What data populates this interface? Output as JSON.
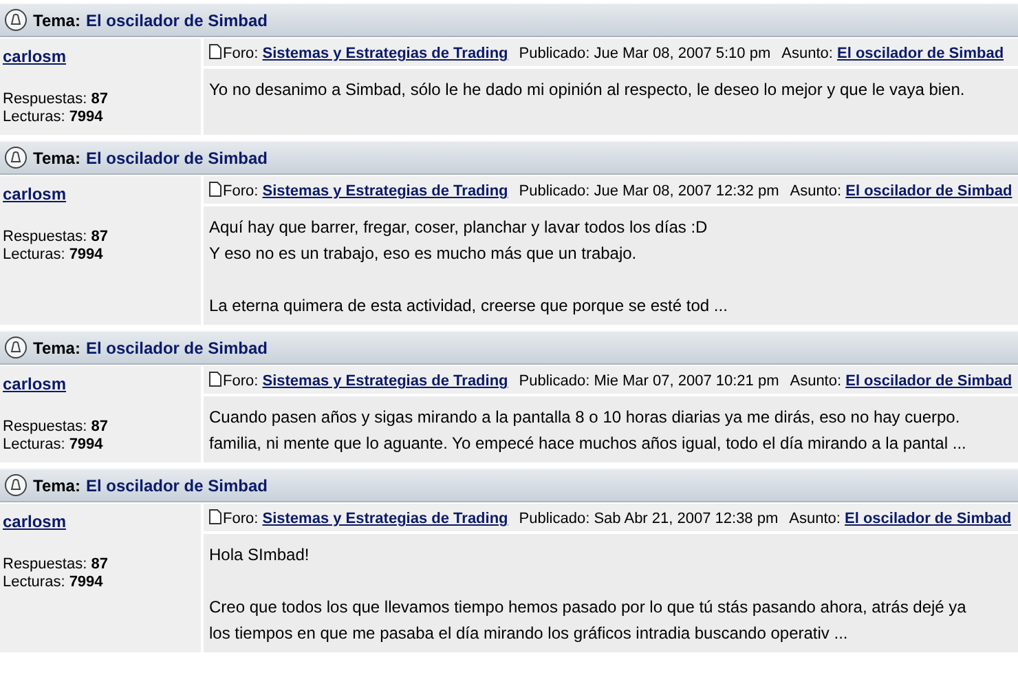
{
  "posts": [
    {
      "topic_label": "Tema:",
      "topic": "El oscilador de Simbad",
      "author": "carlosm",
      "replies_label": "Respuestas:",
      "replies": "87",
      "reads_label": "Lecturas:",
      "reads": "7994",
      "forum_label": "Foro:",
      "forum": "Sistemas y Estrategias de Trading",
      "published": "Publicado: Jue Mar 08, 2007 5:10 pm",
      "subject_label": "Asunto:",
      "subject": "El oscilador de Simbad",
      "paragraphs": [
        [
          "Yo no desanimo a Simbad, sólo le he dado mi opinión al respecto, le deseo lo mejor y que le vaya bien."
        ]
      ]
    },
    {
      "topic_label": "Tema:",
      "topic": "El oscilador de Simbad",
      "author": "carlosm",
      "replies_label": "Respuestas:",
      "replies": "87",
      "reads_label": "Lecturas:",
      "reads": "7994",
      "forum_label": "Foro:",
      "forum": "Sistemas y Estrategias de Trading",
      "published": "Publicado: Jue Mar 08, 2007 12:32 pm",
      "subject_label": "Asunto:",
      "subject": "El oscilador de Simbad",
      "paragraphs": [
        [
          "Aquí hay que barrer, fregar, coser, planchar y lavar todos los días :D",
          "Y eso no es un trabajo, eso es mucho más que un trabajo."
        ],
        [
          "La eterna quimera de esta actividad, creerse que porque se esté tod ..."
        ]
      ]
    },
    {
      "topic_label": "Tema:",
      "topic": "El oscilador de Simbad",
      "author": "carlosm",
      "replies_label": "Respuestas:",
      "replies": "87",
      "reads_label": "Lecturas:",
      "reads": "7994",
      "forum_label": "Foro:",
      "forum": "Sistemas y Estrategias de Trading",
      "published": "Publicado: Mie Mar 07, 2007 10:21 pm",
      "subject_label": "Asunto:",
      "subject": "El oscilador de Simbad",
      "paragraphs": [
        [
          "Cuando pasen años y sigas mirando a la pantalla 8 o 10 horas diarias ya me dirás, eso no hay cuerpo.",
          "familia, ni mente que lo aguante. Yo empecé hace muchos años igual, todo el día mirando a la pantal ..."
        ]
      ]
    },
    {
      "topic_label": "Tema:",
      "topic": "El oscilador de Simbad",
      "author": "carlosm",
      "replies_label": "Respuestas:",
      "replies": "87",
      "reads_label": "Lecturas:",
      "reads": "7994",
      "forum_label": "Foro:",
      "forum": "Sistemas y Estrategias de Trading",
      "published": "Publicado: Sab Abr 21, 2007 12:38 pm",
      "subject_label": "Asunto:",
      "subject": "El oscilador de Simbad",
      "paragraphs": [
        [
          "Hola SImbad!"
        ],
        [
          "Creo que todos los que llevamos tiempo hemos pasado por lo que tú stás pasando ahora, atrás dejé ya",
          "los tiempos en que me pasaba el día mirando los gráficos intradia buscando operativ ..."
        ]
      ]
    }
  ]
}
